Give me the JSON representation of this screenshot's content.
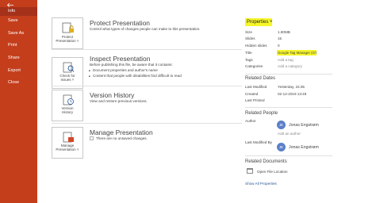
{
  "sidebar": {
    "items": [
      {
        "label": "Info",
        "active": true
      },
      {
        "label": "Save"
      },
      {
        "label": "Save As"
      },
      {
        "label": "Print"
      },
      {
        "label": "Share"
      },
      {
        "label": "Export"
      },
      {
        "label": "Close"
      }
    ],
    "colors": {
      "background": "#c43e1c",
      "active": "#a5311a"
    }
  },
  "sections": {
    "protect": {
      "card_label": [
        "Protect",
        "Presentation ˅"
      ],
      "icon": "lock-icon",
      "title": "Protect Presentation",
      "description": "Control what types of changes people can make to this presentation."
    },
    "inspect": {
      "card_label": [
        "Check for",
        "Issues ˅"
      ],
      "icon": "inspect-document-icon",
      "title": "Inspect Presentation",
      "description": "Before publishing this file, be aware that it contains:",
      "bullets": [
        "Document properties and author's name",
        "Content that people with disabilities find difficult to read"
      ]
    },
    "version": {
      "card_label": [
        "Version",
        "History"
      ],
      "icon": "version-history-icon",
      "title": "Version History",
      "description": "View and restore previous versions."
    },
    "manage": {
      "card_label": [
        "Manage",
        "Presentation ˅"
      ],
      "icon": "manage-presentation-icon",
      "title": "Manage Presentation",
      "description": "There are no unsaved changes."
    }
  },
  "properties": {
    "header": "Properties ˅",
    "rows": [
      {
        "label": "Size",
        "value": "1.80MB"
      },
      {
        "label": "Slides",
        "value": "15"
      },
      {
        "label": "Hidden slides",
        "value": "0"
      },
      {
        "label": "Title",
        "value": "Google Tag Manager (GT"
      },
      {
        "label": "Tags",
        "value": "Add a tag"
      },
      {
        "label": "Categories",
        "value": "Add a category"
      }
    ],
    "highlight_color": "#f6f62a"
  },
  "related_dates": {
    "header": "Related Dates",
    "rows": [
      {
        "label": "Last Modified",
        "value": "Yesterday, 15:35"
      },
      {
        "label": "Created",
        "value": "02-12-2019 13:49"
      },
      {
        "label": "Last Printed",
        "value": ""
      }
    ]
  },
  "related_people": {
    "header": "Related People",
    "author_label": "Author",
    "author_initials": "JE",
    "author_name": "Jonas Engstrøm",
    "add_author": "Add an author",
    "modified_label": "Last Modified By",
    "modified_initials": "JE",
    "modified_name": "Jonas Engstrøm"
  },
  "related_documents": {
    "header": "Related Documents",
    "open_location": "Open File Location",
    "show_all": "Show All Properties"
  }
}
